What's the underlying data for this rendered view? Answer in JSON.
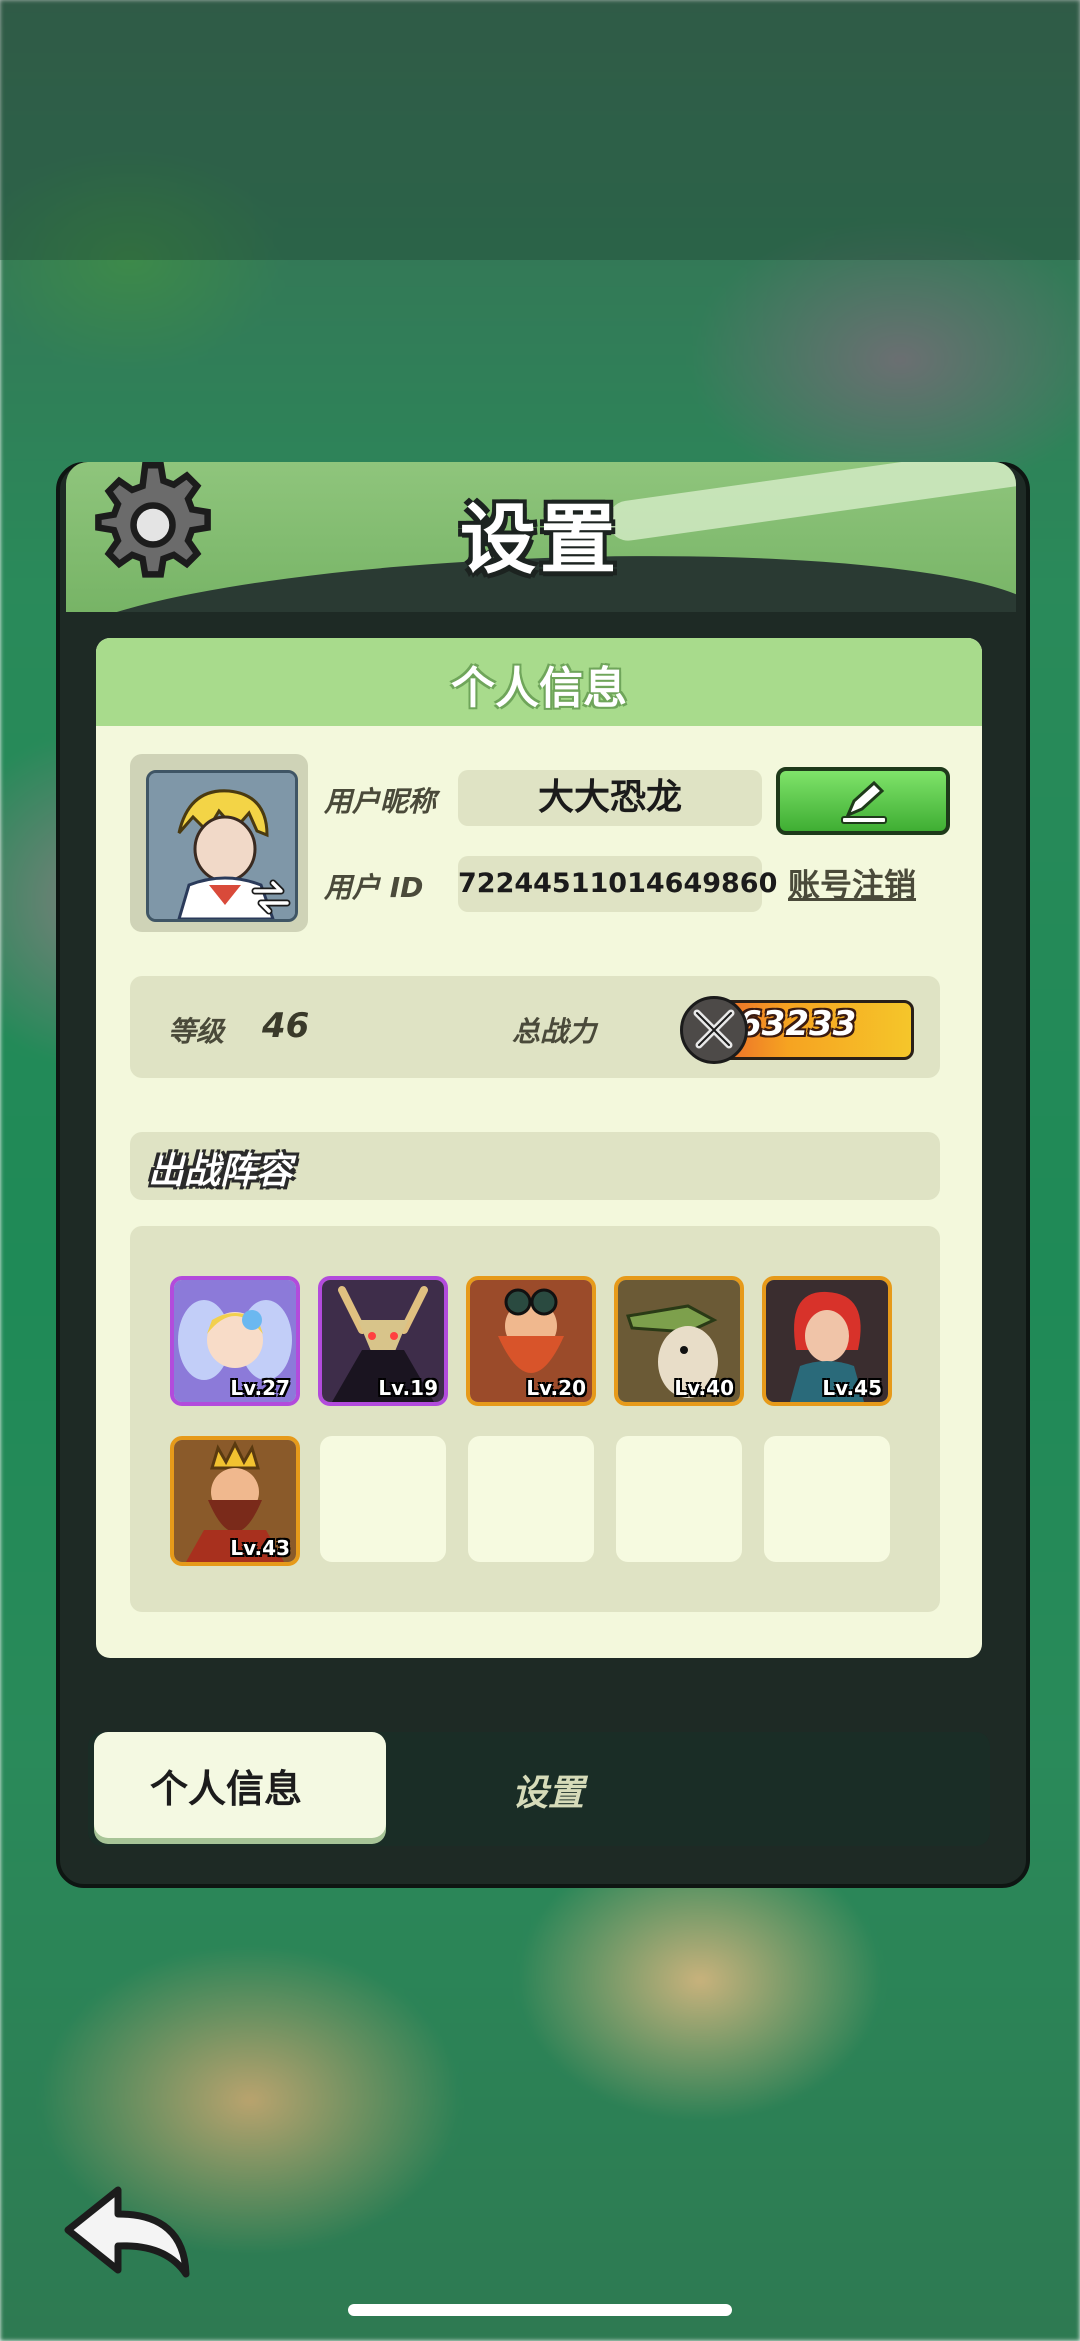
{
  "header": {
    "title": "设置"
  },
  "profile": {
    "panel_title": "个人信息",
    "nickname_label": "用户昵称",
    "nickname": "大大恐龙",
    "uid_label": "用户  ID",
    "uid": "72244511014649860",
    "account_cancel": "账号注销",
    "level_label": "等级",
    "level": "46",
    "power_label": "总战力",
    "power": "63233"
  },
  "lineup": {
    "title": "出战阵容",
    "heroes": [
      {
        "level": "Lv.27",
        "rarity": "purple",
        "color": "#8c7ad9"
      },
      {
        "level": "Lv.19",
        "rarity": "purple",
        "color": "#3e2d4a"
      },
      {
        "level": "Lv.20",
        "rarity": "orange",
        "color": "#9b4b2a"
      },
      {
        "level": "Lv.40",
        "rarity": "orange",
        "color": "#6b5a36"
      },
      {
        "level": "Lv.45",
        "rarity": "orange",
        "color": "#3a2d2f"
      },
      {
        "level": "Lv.43",
        "rarity": "orange",
        "color": "#8a5a2a"
      }
    ]
  },
  "tabs": {
    "profile": "个人信息",
    "settings": "设置"
  },
  "colors": {
    "accent_green": "#8fc57c",
    "panel_bg": "#f3f8dc",
    "purple_rarity": "#b24bdc",
    "orange_rarity": "#e69a1a"
  },
  "icons": {
    "settings": "gear-icon",
    "edit": "pencil-icon",
    "switch": "swap-icon",
    "power": "crossed-swords-icon",
    "back": "back-arrow-icon"
  }
}
